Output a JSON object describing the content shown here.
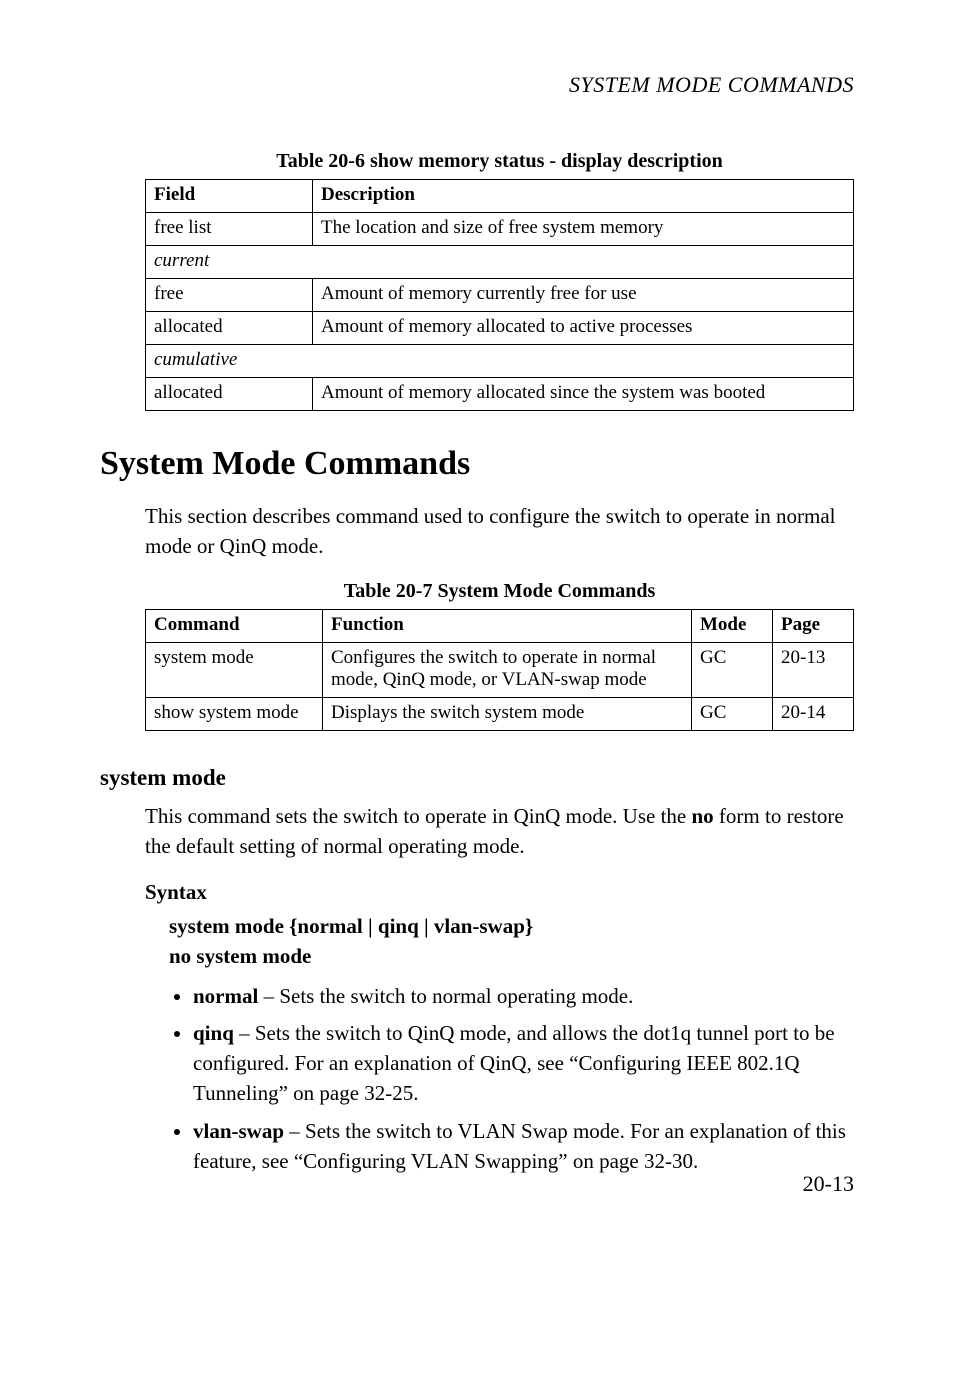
{
  "running_head": "SYSTEM MODE COMMANDS",
  "table1": {
    "caption": "Table 20-6  show memory status - display description",
    "head": {
      "field": "Field",
      "desc": "Description"
    },
    "rows": {
      "freelist": {
        "field": "free list",
        "desc": "The location and size of free system memory"
      },
      "section_current": "current",
      "free": {
        "field": "free",
        "desc": "Amount of memory currently free for use"
      },
      "allocated": {
        "field": "allocated",
        "desc": "Amount of memory allocated to active processes"
      },
      "section_cumulative": "cumulative",
      "cum_allocated": {
        "field": "allocated",
        "desc": "Amount of memory allocated since the system was booted"
      }
    }
  },
  "section_title": "System Mode Commands",
  "intro": "This section describes command used to configure the switch to operate in normal mode or QinQ mode.",
  "table2": {
    "caption": "Table 20-7  System Mode Commands",
    "head": {
      "cmd": "Command",
      "func": "Function",
      "mode": "Mode",
      "page": "Page"
    },
    "rows": {
      "r1": {
        "cmd": "system mode",
        "func": "Configures the switch to operate in normal mode, QinQ mode, or VLAN-swap mode",
        "mode": "GC",
        "page": "20-13"
      },
      "r2": {
        "cmd": "show system mode",
        "func": "Displays the switch system mode",
        "mode": "GC",
        "page": "20-14"
      }
    }
  },
  "subhead": "system mode",
  "cmd_desc_pre": "This command sets the switch to operate in QinQ mode. Use the ",
  "cmd_desc_bold": "no",
  "cmd_desc_post": " form to restore the default setting of normal operating mode.",
  "syntax": {
    "heading": "Syntax",
    "line1_pre": "system mode ",
    "line1_opts": "{normal | qinq | vlan-swap}",
    "line2": "no system mode",
    "opts": {
      "normal": {
        "kw": "normal",
        "text": " – Sets the switch to normal operating mode."
      },
      "qinq": {
        "kw": "qinq",
        "text": " – Sets the switch to QinQ mode, and allows the dot1q tunnel port to be configured. For an explanation of QinQ, see “Configuring IEEE 802.1Q Tunneling” on page 32-25."
      },
      "vlan": {
        "kw": "vlan-swap",
        "text": " – Sets the switch to VLAN Swap mode. For an explanation of this feature, see “Configuring VLAN Swapping” on page 32-30."
      }
    }
  },
  "page_number": "20-13"
}
